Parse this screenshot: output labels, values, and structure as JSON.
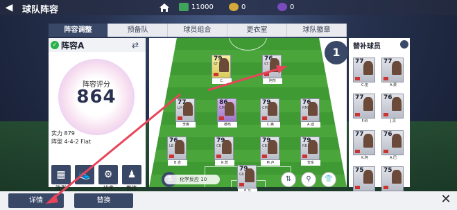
{
  "header": {
    "title": "球队阵容",
    "back_glyph": "◀",
    "coins": "11000",
    "gold": "0",
    "points": "0"
  },
  "tabs": [
    "阵容调整",
    "预备队",
    "球员组合",
    "更衣室",
    "球队徽章"
  ],
  "left_panel": {
    "lineup_name": "阵容A",
    "rating_label": "阵容评分",
    "rating_value": "864",
    "strength_label": "实力",
    "strength_value": "879",
    "formation_label": "阵型",
    "formation_value": "4-4-2 Flat",
    "tool_labels": [
      "阵型",
      "",
      "战术",
      "教练"
    ]
  },
  "pitch": {
    "chemistry_label": "化学反应",
    "chemistry_value": "10",
    "players": [
      {
        "rating": "79",
        "pos": "ST",
        "name": "C.",
        "style": "gold"
      },
      {
        "rating": "76",
        "pos": "ST",
        "name": "阿尔",
        "style": "grey"
      },
      {
        "rating": "77",
        "pos": "LM",
        "name": "李奥",
        "style": "grey"
      },
      {
        "rating": "86",
        "pos": "CM",
        "name": "德布",
        "style": "purple"
      },
      {
        "rating": "79",
        "pos": "CM",
        "name": "C.奥",
        "style": "grey"
      },
      {
        "rating": "76",
        "pos": "RM",
        "name": "A.迪",
        "style": "grey"
      },
      {
        "rating": "76",
        "pos": "LB",
        "name": "B.吉",
        "style": "grey"
      },
      {
        "rating": "79",
        "pos": "CB",
        "name": "R.普",
        "style": "grey"
      },
      {
        "rating": "79",
        "pos": "CB",
        "name": "M.卢",
        "style": "grey"
      },
      {
        "rating": "79",
        "pos": "RB",
        "name": "安东",
        "style": "grey"
      },
      {
        "rating": "79",
        "pos": "GK",
        "name": "E.马",
        "style": "grey"
      }
    ]
  },
  "subs_panel": {
    "title": "替补球员",
    "players": [
      {
        "rating": "77",
        "name": "C.伍"
      },
      {
        "rating": "77",
        "name": "A.费"
      },
      {
        "rating": "77",
        "name": "F.科"
      },
      {
        "rating": "76",
        "name": "J.贝"
      },
      {
        "rating": "77",
        "name": "K.阿"
      },
      {
        "rating": "76",
        "name": "A.巴"
      },
      {
        "rating": "75",
        "name": "M.塞"
      },
      {
        "rating": "75",
        "name": "B.夸"
      },
      {
        "rating": "75",
        "name": "J.莫"
      }
    ]
  },
  "annotation_badge": "1",
  "bottom": {
    "detail_label": "详情",
    "replace_label": "替换",
    "close_glyph": "✕"
  },
  "colors": {
    "accent": "#3a4868",
    "arrow": "#e8445a",
    "pitch_green": "#4aa63a"
  }
}
